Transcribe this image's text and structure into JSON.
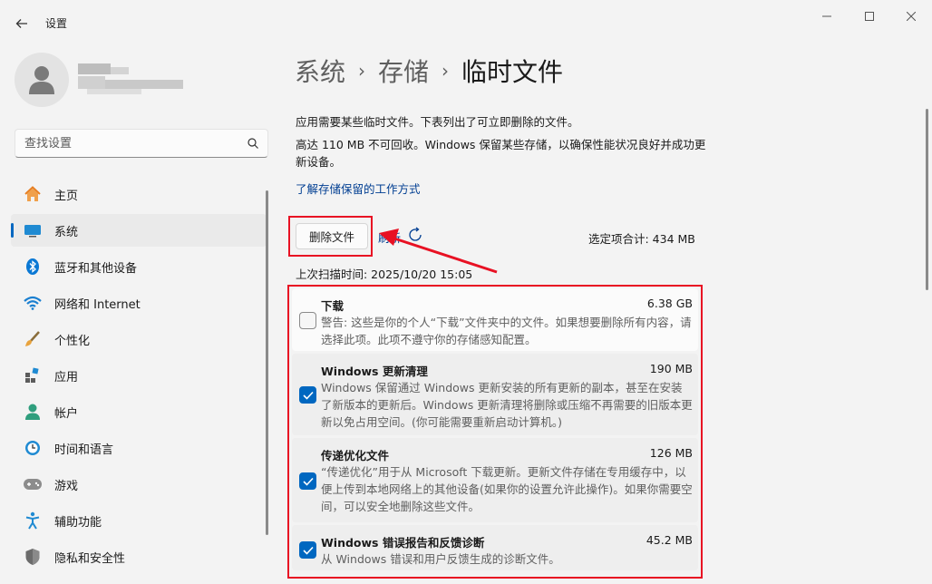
{
  "window": {
    "title": "设置"
  },
  "sidebar": {
    "search_placeholder": "查找设置",
    "items": [
      {
        "label": "主页",
        "icon": "home-icon"
      },
      {
        "label": "系统",
        "icon": "system-icon",
        "active": true
      },
      {
        "label": "蓝牙和其他设备",
        "icon": "bluetooth-icon"
      },
      {
        "label": "网络和 Internet",
        "icon": "wifi-icon"
      },
      {
        "label": "个性化",
        "icon": "brush-icon"
      },
      {
        "label": "应用",
        "icon": "apps-icon"
      },
      {
        "label": "帐户",
        "icon": "account-icon"
      },
      {
        "label": "时间和语言",
        "icon": "clock-globe-icon"
      },
      {
        "label": "游戏",
        "icon": "gamepad-icon"
      },
      {
        "label": "辅助功能",
        "icon": "accessibility-icon"
      },
      {
        "label": "隐私和安全性",
        "icon": "shield-icon"
      }
    ]
  },
  "breadcrumb": {
    "part1": "系统",
    "part2": "存储",
    "current": "临时文件"
  },
  "main": {
    "desc1": "应用需要某些临时文件。下表列出了可立即删除的文件。",
    "desc2": "高达 110 MB 不可回收。Windows 保留某些存储，以确保性能状况良好并成功更新设备。",
    "learn_link": "了解存储保留的工作方式",
    "delete_button": "删除文件",
    "refresh": "刷新",
    "selected_total": "选定项合计: 434 MB",
    "last_scan": "上次扫描时间: 2025/10/20 15:05"
  },
  "files": [
    {
      "title": "下载",
      "size": "6.38 GB",
      "checked": false,
      "desc": "警告: 这些是你的个人“下载”文件夹中的文件。如果想要删除所有内容，请选择此项。此项不遵守你的存储感知配置。"
    },
    {
      "title": "Windows 更新清理",
      "size": "190 MB",
      "checked": true,
      "desc": "Windows 保留通过 Windows 更新安装的所有更新的副本，甚至在安装了新版本的更新后。Windows 更新清理将删除或压缩不再需要的旧版本更新以免占用空间。(你可能需要重新启动计算机。)"
    },
    {
      "title": "传递优化文件",
      "size": "126 MB",
      "checked": true,
      "desc": "“传递优化”用于从 Microsoft 下载更新。更新文件存储在专用缓存中，以便上传到本地网络上的其他设备(如果你的设置允许此操作)。如果你需要空间，可以安全地删除这些文件。"
    },
    {
      "title": "Windows 错误报告和反馈诊断",
      "size": "45.2 MB",
      "checked": true,
      "desc": "从 Windows 错误和用户反馈生成的诊断文件。"
    }
  ],
  "colors": {
    "accent": "#0067c0",
    "highlight": "#e81123",
    "link": "#003e92"
  }
}
